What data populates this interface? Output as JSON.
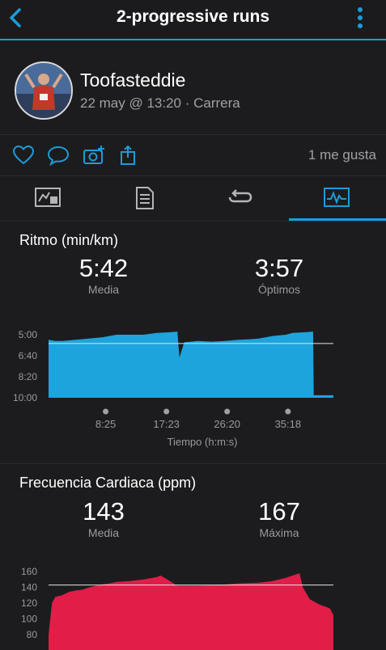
{
  "header": {
    "title": "2-progressive runs"
  },
  "activity": {
    "user": "Toofasteddie",
    "meta": "22 may @ 13:20 · Carrera",
    "likes": "1 me gusta"
  },
  "pace": {
    "title": "Ritmo (min/km)",
    "avg_value": "5:42",
    "avg_label": "Media",
    "best_value": "3:57",
    "best_label": "Óptimos",
    "x_axis_label": "Tiempo (h:m:s)"
  },
  "hr": {
    "title": "Frecuencia Cardiaca (ppm)",
    "avg_value": "143",
    "avg_label": "Media",
    "max_value": "167",
    "max_label": "Máxima"
  },
  "colors": {
    "accent": "#1d9bd8",
    "pace_fill": "#1ea4dc",
    "hr_fill": "#e11d48",
    "bg": "#1c1c1e"
  },
  "chart_data": [
    {
      "type": "area",
      "title": "Ritmo (min/km)",
      "ylabel": "Ritmo (min/km)",
      "xlabel": "Tiempo (h:m:s)",
      "y_ticks": [
        "5:00",
        "6:40",
        "8:20",
        "10:00"
      ],
      "x_ticks": [
        "8:25",
        "17:23",
        "26:20",
        "35:18"
      ],
      "ylim_sec": [
        300,
        600
      ],
      "avg_line": 5.7,
      "x_min": [
        0,
        1,
        2,
        3,
        4,
        5,
        6,
        7,
        8,
        9,
        10,
        12,
        14,
        16,
        18,
        19,
        19.3,
        20,
        22,
        24,
        26,
        28,
        30,
        31,
        33,
        35,
        36,
        38,
        39,
        39.1,
        42
      ],
      "y_minpkm": [
        5.4,
        5.5,
        5.5,
        5.45,
        5.4,
        5.35,
        5.3,
        5.25,
        5.2,
        5.1,
        5.0,
        5.0,
        5.0,
        4.85,
        4.8,
        4.75,
        6.8,
        5.6,
        5.5,
        5.55,
        5.5,
        5.4,
        5.35,
        5.3,
        5.1,
        5.0,
        4.85,
        4.8,
        4.75,
        9.8,
        9.8
      ]
    },
    {
      "type": "area",
      "title": "Frecuencia Cardiaca (ppm)",
      "ylabel": "Frecuencia Cardiaca (ppm)",
      "y_ticks": [
        "160",
        "140",
        "120",
        "100",
        "80"
      ],
      "ylim": [
        80,
        160
      ],
      "avg_line": 143,
      "x_min": [
        0,
        0.5,
        1,
        2,
        3,
        4,
        5,
        6,
        7,
        8,
        9,
        10,
        12,
        14,
        16,
        16.5,
        17.5,
        19,
        22,
        25,
        28,
        31,
        33,
        35,
        36,
        37,
        37.5,
        38.5,
        40,
        41,
        41.5,
        42
      ],
      "y_bpm": [
        80,
        120,
        128,
        130,
        134,
        136,
        137,
        140,
        142,
        144,
        145,
        147,
        148,
        150,
        153,
        155,
        150,
        142,
        142,
        143,
        145,
        146,
        148,
        152,
        155,
        158,
        140,
        125,
        118,
        115,
        113,
        105
      ]
    }
  ]
}
